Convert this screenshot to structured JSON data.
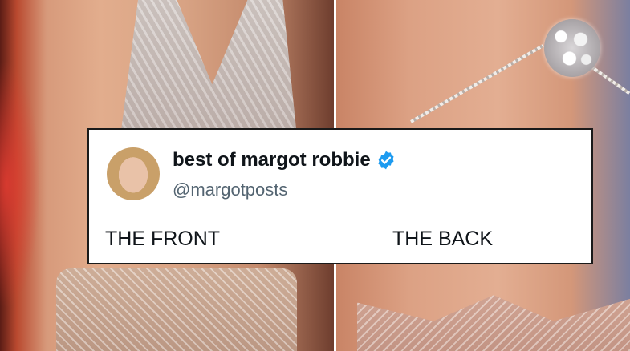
{
  "tweet": {
    "display_name": "best of margot robbie",
    "handle": "@margotposts",
    "verified_icon": "verified-badge-icon",
    "text_left": "THE FRONT",
    "text_right": "THE BACK"
  },
  "colors": {
    "verified_blue": "#1d9bf0",
    "name_text": "#0f1419",
    "handle_text": "#536471",
    "card_border": "#1a1a1a"
  }
}
